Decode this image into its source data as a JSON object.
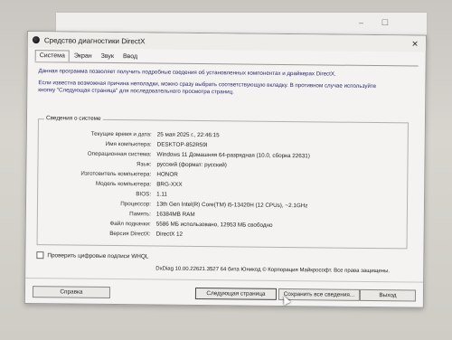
{
  "window": {
    "title": "Средство диагностики DirectX",
    "close": "✕"
  },
  "tabs": [
    {
      "label": "Система"
    },
    {
      "label": "Экран"
    },
    {
      "label": "Звук"
    },
    {
      "label": "Ввод"
    }
  ],
  "description": {
    "line1": "Данная программа позволяет получить подробные сведения об установленных компонентах и драйверах DirectX.",
    "line2": "Если известна возможная причина неполадки, можно сразу выбрать соответствующую вкладку. В противном случае используйте",
    "line3": "кнопку \"Следующая страница\" для последовательного просмотра страниц."
  },
  "system_info": {
    "title": "Сведения о системе",
    "rows": [
      {
        "label": "Текущие время и дата:",
        "value": "25 мая 2025 г., 22:46:15"
      },
      {
        "label": "Имя компьютера:",
        "value": "DESKTOP-852R59I"
      },
      {
        "label": "Операционная система:",
        "value": "Windows 11 Домашняя 64-разрядная (10.0, сборка 22631)"
      },
      {
        "label": "Язык:",
        "value": "русский (формат: русский)"
      },
      {
        "label": "Изготовитель компьютера:",
        "value": "HONOR"
      },
      {
        "label": "Модель компьютера:",
        "value": "BRG-XXX"
      },
      {
        "label": "BIOS:",
        "value": "1.11"
      },
      {
        "label": "Процессор:",
        "value": "13th Gen Intel(R) Core(TM) i5-13420H (12 CPUs), ~2.1GHz"
      },
      {
        "label": "Память:",
        "value": "16384MB RAM"
      },
      {
        "label": "Файл подкачки:",
        "value": "5586 МБ использовано, 12953 МБ свободно"
      },
      {
        "label": "Версия DirectX:",
        "value": "DirectX 12"
      }
    ]
  },
  "whql": {
    "label": "Проверить цифровые подписи WHQL"
  },
  "copyright": "DxDiag 10.00.22621.3527 64 бита Юникод © Корпорация Майкрософт. Все права защищены.",
  "buttons": {
    "help": "Справка",
    "next": "Следующая страница",
    "save": "Сохранить все сведения...",
    "exit": "Выход"
  }
}
